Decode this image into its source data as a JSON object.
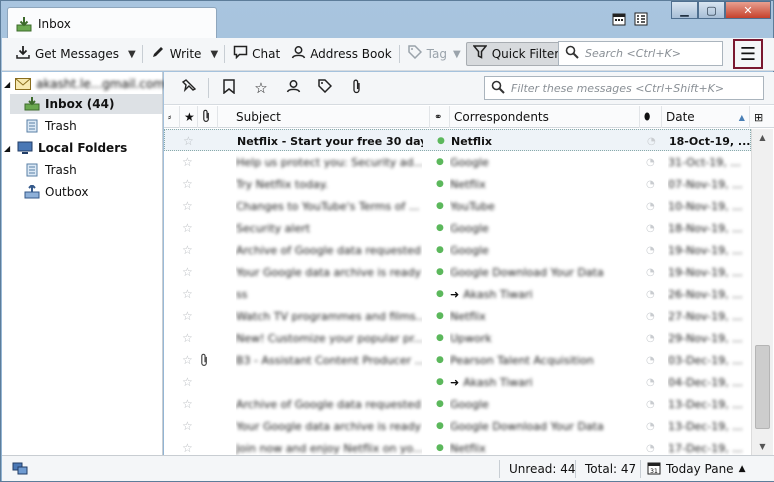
{
  "window": {
    "tab_title": "Inbox",
    "accent_color": "#7a1830"
  },
  "toolbar": {
    "get_messages": "Get Messages",
    "write": "Write",
    "chat": "Chat",
    "address_book": "Address Book",
    "tag": "Tag",
    "quick_filter": "Quick Filter",
    "search_placeholder": "Search <Ctrl+K>"
  },
  "folders": {
    "account": "akasht.le...gmail.com",
    "inbox": "Inbox (44)",
    "trash": "Trash",
    "local_folders": "Local Folders",
    "local_trash": "Trash",
    "outbox": "Outbox"
  },
  "quick_filter": {
    "placeholder": "Filter these messages <Ctrl+Shift+K>"
  },
  "columns": {
    "subject": "Subject",
    "correspondents": "Correspondents",
    "date": "Date"
  },
  "messages": [
    {
      "subject": "Netflix - Start your free 30 days.",
      "correspondent": "Netflix",
      "date": "18-Oct-19, ...",
      "attachment": false,
      "arrow": false
    },
    {
      "subject": "Help us protect you: Security ad...",
      "correspondent": "Google",
      "date": "31-Oct-19, ...",
      "attachment": false,
      "arrow": false
    },
    {
      "subject": "Try Netflix today.",
      "correspondent": "Netflix",
      "date": "07-Nov-19, ...",
      "attachment": false,
      "arrow": false
    },
    {
      "subject": "Changes to YouTube's Terms of ...",
      "correspondent": "YouTube",
      "date": "10-Nov-19, ...",
      "attachment": false,
      "arrow": false
    },
    {
      "subject": "Security alert",
      "correspondent": "Google",
      "date": "18-Nov-19, ...",
      "attachment": false,
      "arrow": false
    },
    {
      "subject": "Archive of Google data requested",
      "correspondent": "Google",
      "date": "19-Nov-19, ...",
      "attachment": false,
      "arrow": false
    },
    {
      "subject": "Your Google data archive is ready",
      "correspondent": "Google Download Your Data",
      "date": "19-Nov-19, ...",
      "attachment": false,
      "arrow": false
    },
    {
      "subject": "ss",
      "correspondent": "Akash Tiwari",
      "date": "26-Nov-19, ...",
      "attachment": false,
      "arrow": true
    },
    {
      "subject": "Watch TV programmes and films...",
      "correspondent": "Netflix",
      "date": "27-Nov-19, ...",
      "attachment": false,
      "arrow": false
    },
    {
      "subject": "New! Customize your popular pr...",
      "correspondent": "Upwork",
      "date": "29-Nov-19, ...",
      "attachment": false,
      "arrow": false
    },
    {
      "subject": "B3 - Assistant Content Producer ...",
      "correspondent": "Pearson Talent Acquisition",
      "date": "03-Dec-19, ...",
      "attachment": true,
      "arrow": false
    },
    {
      "subject": "",
      "correspondent": "Akash Tiwari",
      "date": "04-Dec-19, ...",
      "attachment": false,
      "arrow": true
    },
    {
      "subject": "Archive of Google data requested",
      "correspondent": "Google",
      "date": "13-Dec-19, ...",
      "attachment": false,
      "arrow": false
    },
    {
      "subject": "Your Google data archive is ready",
      "correspondent": "Google Download Your Data",
      "date": "13-Dec-19, ...",
      "attachment": false,
      "arrow": false
    },
    {
      "subject": "Join now and enjoy Netflix on yo...",
      "correspondent": "Netflix",
      "date": "17-Dec-19, ...",
      "attachment": false,
      "arrow": false
    }
  ],
  "status": {
    "unread": "Unread: 44",
    "total": "Total: 47",
    "today_pane": "Today Pane"
  }
}
